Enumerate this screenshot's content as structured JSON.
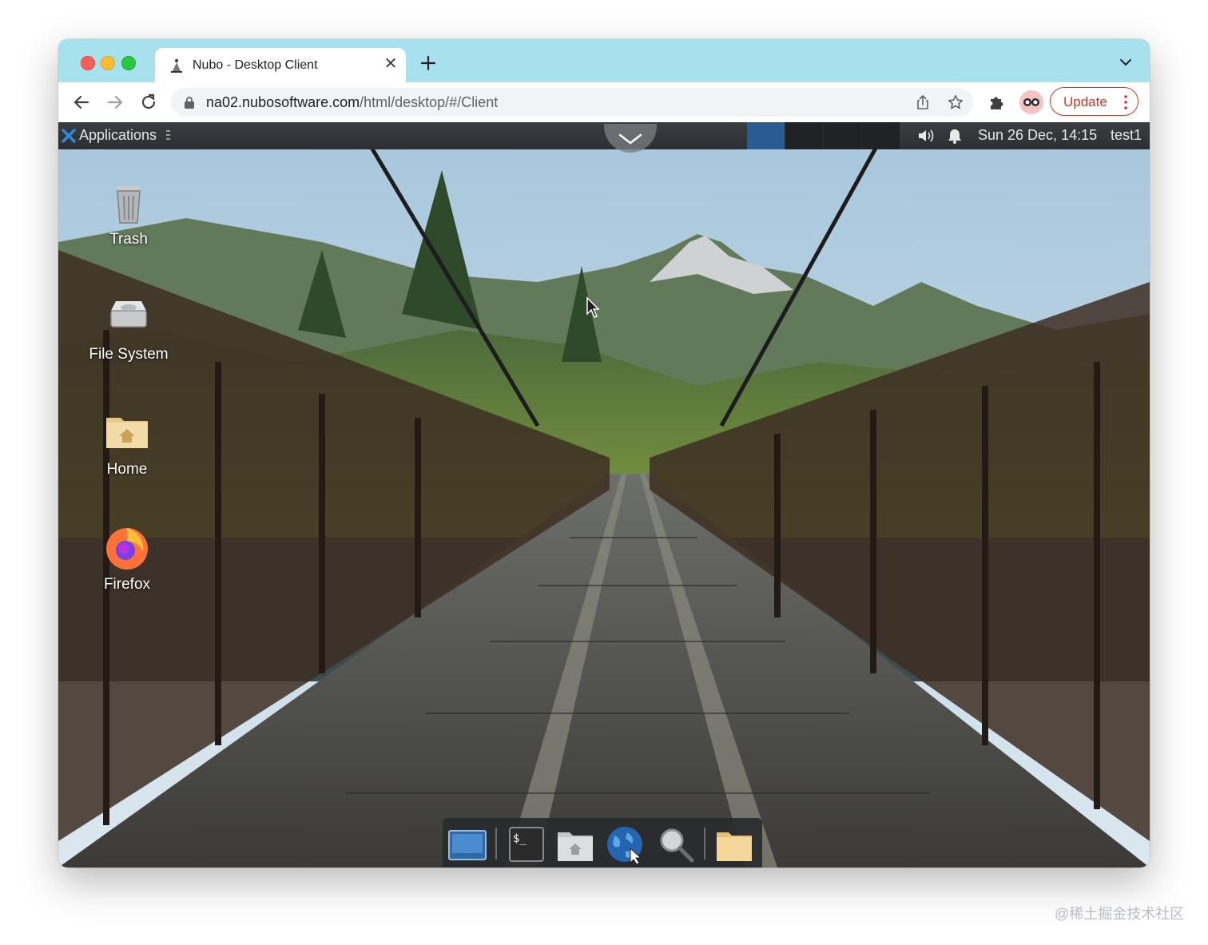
{
  "browser": {
    "tab_title": "Nubo - Desktop Client",
    "url_host": "na02.nubosoftware.com",
    "url_path": "/html/desktop/#/Client",
    "update_label": "Update"
  },
  "desktop": {
    "panel": {
      "applications_label": "Applications",
      "clock": "Sun 26 Dec, 14:15",
      "user": "test1"
    },
    "icons": [
      {
        "label": "Trash",
        "icon": "trash-icon"
      },
      {
        "label": "File System",
        "icon": "drive-icon"
      },
      {
        "label": "Home",
        "icon": "home-folder-icon"
      },
      {
        "label": "Firefox",
        "icon": "firefox-icon"
      }
    ],
    "dock": [
      "show-desktop-icon",
      "terminal-icon",
      "home-folder-icon",
      "web-browser-icon",
      "app-finder-icon",
      "folder-icon"
    ]
  },
  "watermark": "@稀土掘金技术社区",
  "colors": {
    "tabstrip": "#a8e1ee",
    "update_accent": "#d93025",
    "panel": "#2c2e32",
    "workspace_active": "#2a5b91"
  }
}
